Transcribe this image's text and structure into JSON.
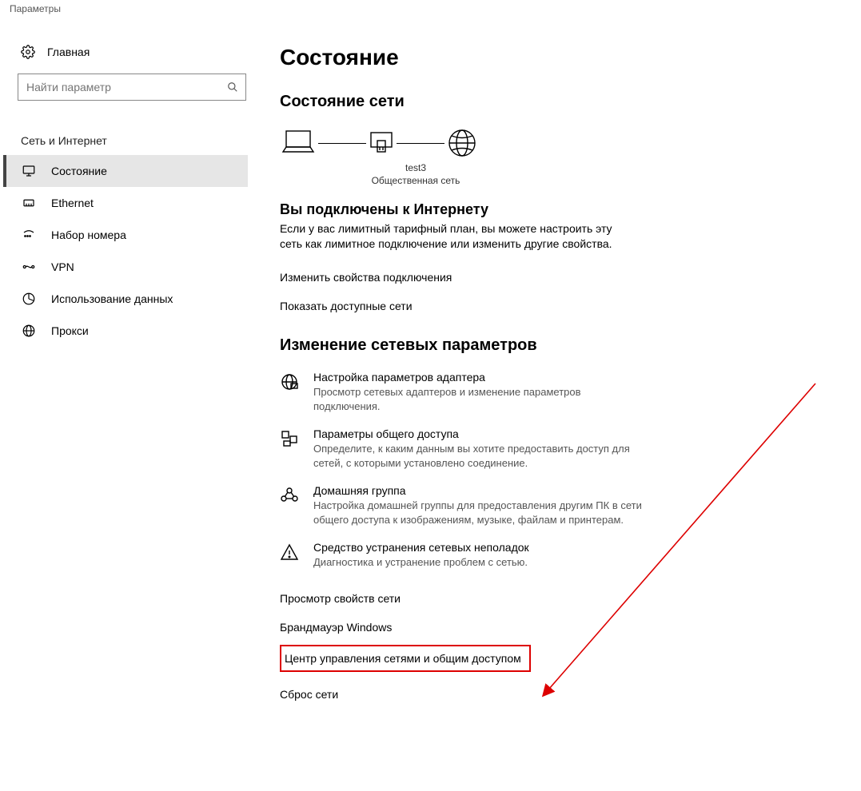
{
  "window": {
    "title": "Параметры"
  },
  "sidebar": {
    "home": "Главная",
    "searchPlaceholder": "Найти параметр",
    "category": "Сеть и Интернет",
    "items": [
      {
        "label": "Состояние"
      },
      {
        "label": "Ethernet"
      },
      {
        "label": "Набор номера"
      },
      {
        "label": "VPN"
      },
      {
        "label": "Использование данных"
      },
      {
        "label": "Прокси"
      }
    ]
  },
  "main": {
    "title": "Состояние",
    "section1": "Состояние сети",
    "diagram": {
      "netName": "test3",
      "netType": "Общественная сеть"
    },
    "connectedHeading": "Вы подключены к Интернету",
    "connectedDesc": "Если у вас лимитный тарифный план, вы можете настроить эту сеть как лимитное подключение или изменить другие свойства.",
    "link1": "Изменить свойства подключения",
    "link2": "Показать доступные сети",
    "section2": "Изменение сетевых параметров",
    "options": [
      {
        "title": "Настройка параметров адаптера",
        "desc": "Просмотр сетевых адаптеров и изменение параметров подключения."
      },
      {
        "title": "Параметры общего доступа",
        "desc": "Определите, к каким данным вы хотите предоставить доступ для сетей, с которыми установлено соединение."
      },
      {
        "title": "Домашняя группа",
        "desc": "Настройка домашней группы для предоставления другим ПК в сети общего доступа к изображениям, музыке, файлам и принтерам."
      },
      {
        "title": "Средство устранения сетевых неполадок",
        "desc": "Диагностика и устранение проблем с сетью."
      }
    ],
    "plainLinks": [
      "Просмотр свойств сети",
      "Брандмауэр Windows",
      "Центр управления сетями и общим доступом",
      "Сброс сети"
    ]
  }
}
